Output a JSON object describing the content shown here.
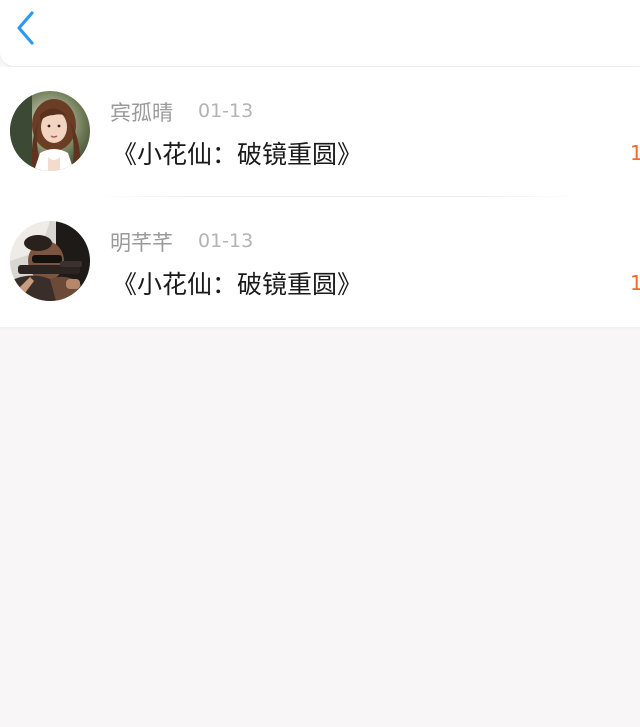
{
  "header": {
    "back_icon": "chevron-left-icon",
    "accent_color": "#2a9af3"
  },
  "items": [
    {
      "name": "宾孤晴",
      "date": "01-13",
      "title": "《小花仙：破镜重圆》",
      "count": "1"
    },
    {
      "name": "明芊芊",
      "date": "01-13",
      "title": "《小花仙：破镜重圆》",
      "count": "1"
    }
  ],
  "colors": {
    "count": "#f26b2b",
    "name": "#9a9a9a",
    "title": "#1a1a1a",
    "background": "#f8f6f6"
  }
}
